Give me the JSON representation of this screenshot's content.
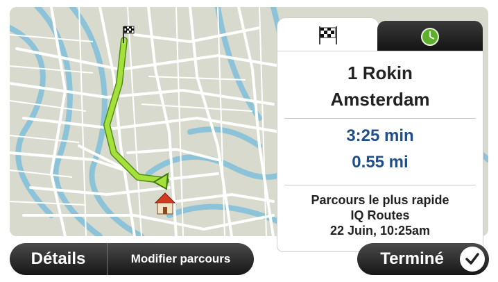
{
  "map": {
    "accent_route_color": "#a6e03c",
    "water_color": "#8cc3d8",
    "road_color": "#ffffff"
  },
  "panel": {
    "tabs": [
      {
        "name": "destination",
        "icon": "checkered-flag-icon",
        "active": true
      },
      {
        "name": "time",
        "icon": "clock-icon",
        "active": false
      }
    ],
    "address_line1": "1 Rokin",
    "address_line2": "Amsterdam",
    "travel_time": "3:25 min",
    "distance": "0.55 mi",
    "route_type": "Parcours le plus rapide",
    "route_source": "IQ Routes",
    "date_time": "22 Juin, 10:25am"
  },
  "toolbar": {
    "details_label": "Détails",
    "modify_label": "Modifier parcours",
    "done_label": "Terminé"
  }
}
